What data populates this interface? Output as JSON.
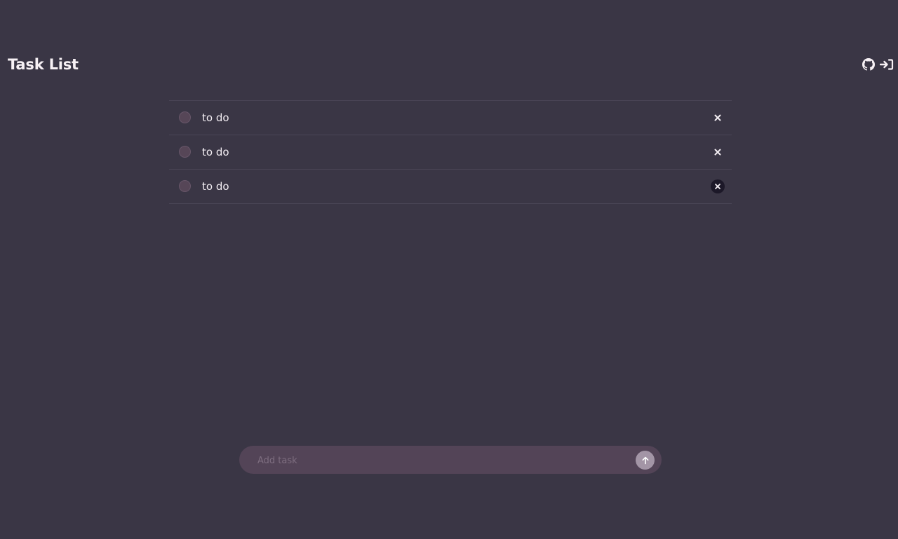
{
  "header": {
    "title": "Task List",
    "icons": [
      "github-icon",
      "sign-in-icon"
    ]
  },
  "tasks": [
    {
      "label": "to do",
      "completed": false
    },
    {
      "label": "to do",
      "completed": false
    },
    {
      "label": "to do",
      "completed": false
    }
  ],
  "composer": {
    "placeholder": "Add task",
    "value": "",
    "submit_icon": "arrow-up-icon"
  },
  "colors": {
    "background": "#3a3645",
    "input_background": "#534457",
    "checkbox": "#564657",
    "send_button": "#a395a6",
    "text": "#f3eef3"
  }
}
